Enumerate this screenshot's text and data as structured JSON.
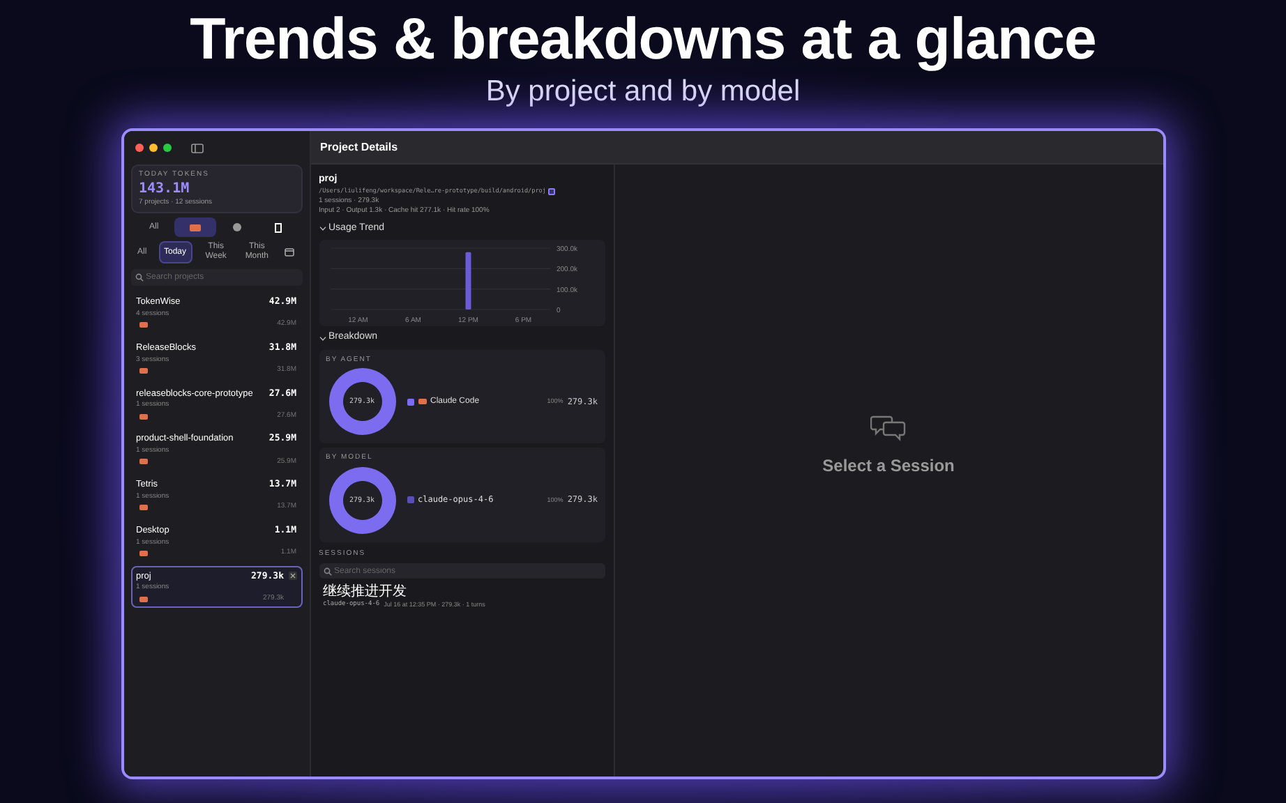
{
  "headline": "Trends & breakdowns at a glance",
  "subtitle": "By project and by model",
  "sidebar": {
    "summary": {
      "label": "TODAY TOKENS",
      "value": "143.1M",
      "detail": "7 projects · 12 sessions"
    },
    "agent_filters": [
      {
        "kind": "text",
        "label": "All",
        "selected": false
      },
      {
        "kind": "chip",
        "selected": true
      },
      {
        "kind": "dot",
        "selected": false
      },
      {
        "kind": "square",
        "selected": false
      }
    ],
    "date_filters": [
      {
        "kind": "text",
        "label": "All",
        "selected": false
      },
      {
        "kind": "text",
        "label": "Today",
        "selected": true
      },
      {
        "kind": "text",
        "label": "This Week",
        "selected": false
      },
      {
        "kind": "text",
        "label": "This Month",
        "selected": false
      },
      {
        "kind": "calendar",
        "selected": false
      }
    ],
    "search": {
      "placeholder": "Search projects"
    },
    "projects": [
      {
        "name": "TokenWise",
        "sessions": "4 sessions",
        "total": "42.9M",
        "agent_total": "42.9M",
        "selected": false
      },
      {
        "name": "ReleaseBlocks",
        "sessions": "3 sessions",
        "total": "31.8M",
        "agent_total": "31.8M",
        "selected": false
      },
      {
        "name": "releaseblocks-core-prototype",
        "sessions": "1 sessions",
        "total": "27.6M",
        "agent_total": "27.6M",
        "selected": false
      },
      {
        "name": "product-shell-foundation",
        "sessions": "1 sessions",
        "total": "25.9M",
        "agent_total": "25.9M",
        "selected": false
      },
      {
        "name": "Tetris",
        "sessions": "1 sessions",
        "total": "13.7M",
        "agent_total": "13.7M",
        "selected": false
      },
      {
        "name": "Desktop",
        "sessions": "1 sessions",
        "total": "1.1M",
        "agent_total": "1.1M",
        "selected": false
      },
      {
        "name": "proj",
        "sessions": "1 sessions",
        "total": "279.3k",
        "agent_total": "279.3k",
        "selected": true
      }
    ]
  },
  "header": {
    "title": "Project Details"
  },
  "project": {
    "name": "proj",
    "path": "/Users/liulifeng/workspace/Rele…re-prototype/build/android/proj",
    "summary": "1 sessions · 279.3k",
    "stats": "Input 2 · Output 1.3k · Cache hit 277.1k · Hit rate 100%"
  },
  "usage_trend": {
    "title": "Usage Trend",
    "expanded": true,
    "chart_data": {
      "type": "bar",
      "categories": [
        "12 AM",
        "6 AM",
        "12 PM",
        "6 PM"
      ],
      "series": [
        {
          "color": "#6b5bd6",
          "values": [
            0,
            0,
            280000,
            0
          ]
        }
      ],
      "ylim": [
        0,
        300000
      ],
      "yticks": [
        {
          "value": 0,
          "label": "0"
        },
        {
          "value": 100000,
          "label": "100.0k"
        },
        {
          "value": 200000,
          "label": "200.0k"
        },
        {
          "value": 300000,
          "label": "300.0k"
        }
      ]
    }
  },
  "breakdown": {
    "title": "Breakdown",
    "expanded": true,
    "groups": [
      {
        "label": "BY AGENT",
        "center": "279.3k",
        "items": [
          {
            "kind": "agent",
            "name": "Claude Code",
            "color": "#7b6cf0",
            "percent": "100%",
            "value": "279.3k"
          }
        ]
      },
      {
        "label": "BY MODEL",
        "center": "279.3k",
        "items": [
          {
            "kind": "model",
            "name": "claude-opus-4-6",
            "color": "#5a4fb8",
            "percent": "100%",
            "value": "279.3k"
          }
        ]
      }
    ]
  },
  "sessions": {
    "label": "SESSIONS",
    "search": {
      "placeholder": "Search sessions"
    },
    "items": [
      {
        "title": "继续推进开发",
        "model": "claude-opus-4-6",
        "meta": "Jul 16 at 12:35 PM · 279.3k · 1 turns"
      }
    ]
  },
  "empty_state": {
    "title": "Select a Session"
  }
}
